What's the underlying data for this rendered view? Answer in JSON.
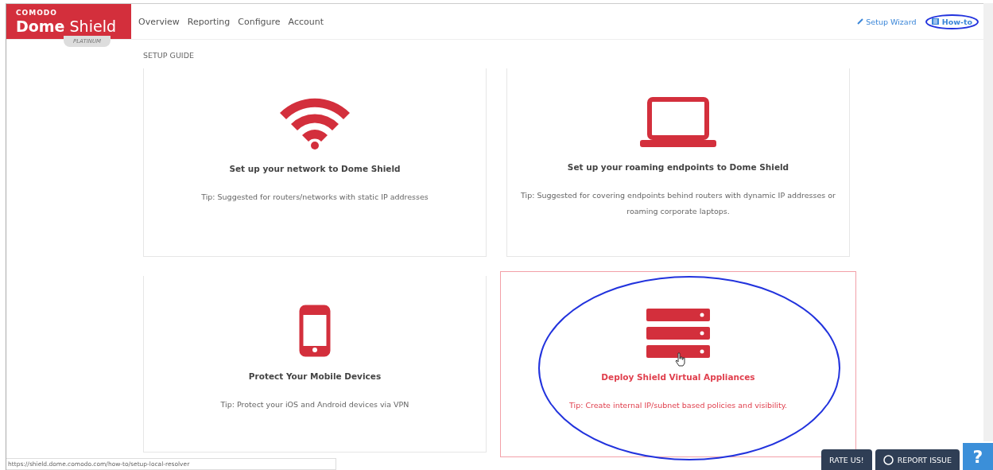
{
  "brand": {
    "company": "COMODO",
    "product_a": "Dome",
    "product_b": "Shield",
    "edition": "PLATINUM"
  },
  "nav": [
    "Overview",
    "Reporting",
    "Configure",
    "Account"
  ],
  "header_links": [
    {
      "kind": "wizard",
      "label": "Setup Wizard",
      "annotated": false
    },
    {
      "kind": "howto",
      "label": "How-to",
      "annotated": true
    }
  ],
  "section_title": "SETUP GUIDE",
  "cards": [
    {
      "kind": "wifi",
      "title": "Set up your network to Dome Shield",
      "tip": "Tip: Suggested for routers/networks with static IP addresses",
      "highlighted": false,
      "annotated": false
    },
    {
      "kind": "laptop",
      "title": "Set up your roaming endpoints to Dome Shield",
      "tip": "Tip: Suggested for covering endpoints behind routers with dynamic IP addresses or roaming corporate laptops.",
      "highlighted": false,
      "annotated": false
    },
    {
      "kind": "phone",
      "title": "Protect Your Mobile Devices",
      "tip": "Tip: Protect your iOS and Android devices via VPN",
      "highlighted": false,
      "annotated": false
    },
    {
      "kind": "server",
      "title": "Deploy Shield Virtual Appliances",
      "tip": "Tip: Create internal IP/subnet based policies and visibility.",
      "highlighted": true,
      "annotated": true
    }
  ],
  "status_url": "https://shield.dome.comodo.com/how-to/setup-local-resolver",
  "footer_buttons": [
    {
      "kind": "rate",
      "label": "RATE US!"
    },
    {
      "kind": "report",
      "label": "REPORT ISSUE"
    },
    {
      "kind": "help",
      "label": "?"
    }
  ]
}
